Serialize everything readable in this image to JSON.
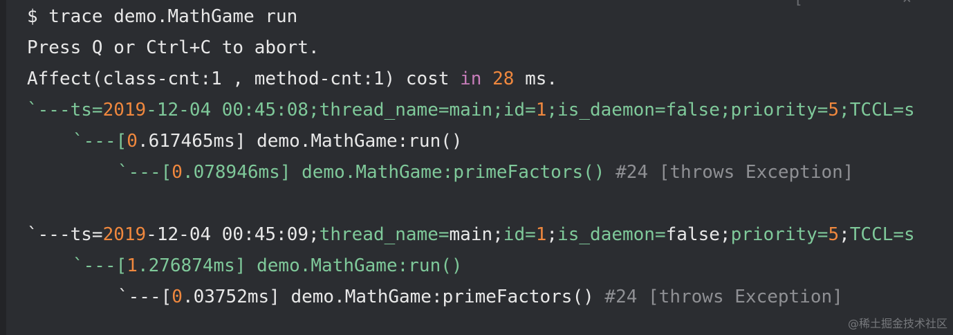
{
  "header_glyph": "[ - ×",
  "watermark": "@稀土掘金技术社区",
  "colors": {
    "background": "#2b2d31",
    "text": "#e8e8e8",
    "green": "#7fc99a",
    "orange": "#f0883e",
    "purple": "#c77dba",
    "gray": "#8f9094"
  },
  "lines": {
    "prompt": "$ trace demo.MathGame run",
    "press_q": "Press Q or Ctrl+C to abort.",
    "affect": {
      "a": "Affect(class-cnt:1 , method-cnt:1) cost ",
      "in": "in",
      "sp": " ",
      "num": "28",
      "ms": " ms."
    },
    "trace1": {
      "root": {
        "p1": "`---ts=",
        "year": "2019",
        "rest1": "-12-04 00:45:08;thread_name=main;id=",
        "id": "1",
        "rest2": ";is_daemon=false;priority=",
        "prio": "5",
        "rest3": ";TCCL=s"
      },
      "child": {
        "p1": "`---[",
        "d": "0",
        "time": ".617465ms] demo.MathGame:run()"
      },
      "leaf": {
        "p1": "`---[",
        "d": "0",
        "time": ".078946ms] demo.MathGame:primeFactors()",
        "tail": " #24 [throws Exception]"
      }
    },
    "trace2": {
      "root": {
        "p1": "`---ts=",
        "year": "2019",
        "date": "-12-04 00:45:09",
        "sc1": ";",
        "tn": "thread_name=",
        "main": "main",
        "sc2": ";",
        "idk": "id=",
        "id": "1",
        "sc3": ";",
        "dk": "is_daemon=",
        "dv": "false",
        "sc4": ";",
        "pk": "priority=",
        "prio": "5",
        "sc5": ";",
        "tc": "TCCL=s"
      },
      "child": {
        "p1": "`---[",
        "d": "1",
        "time": ".276874ms] demo.MathGame:run()"
      },
      "leaf": {
        "p1": "`---[",
        "d": "0",
        "time": ".03752ms] demo.MathGame:primeFactors()",
        "tail": " #24 [throws Exception]"
      }
    }
  }
}
